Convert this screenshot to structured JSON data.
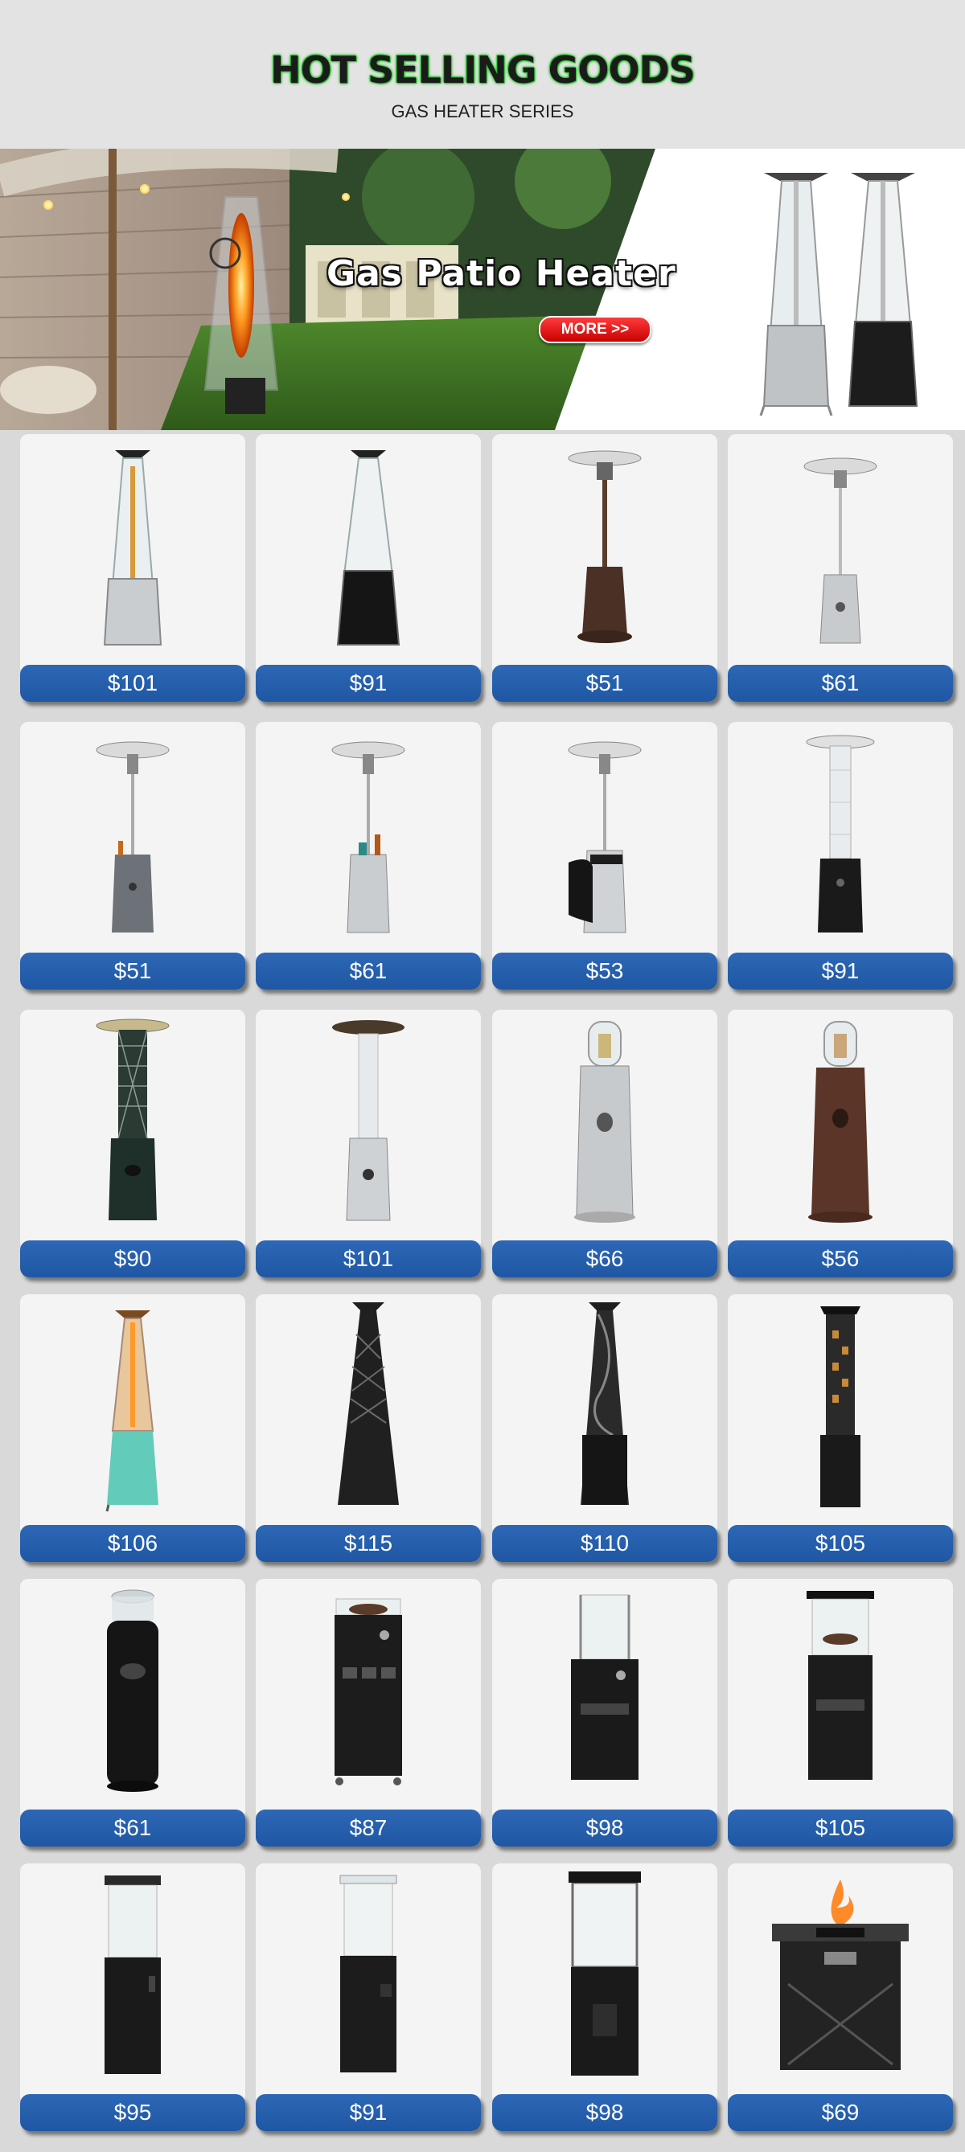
{
  "header": {
    "title": "HOT SELLING GOODS",
    "subtitle": "GAS HEATER SERIES"
  },
  "banner": {
    "headline": "Gas Patio Heater",
    "more_label": "MORE >>"
  },
  "colors": {
    "accent_blue": "#2261ad",
    "title_glow": "#27c52a",
    "more_red": "#e01010"
  },
  "products": [
    {
      "price": "$101",
      "icon": "pyramid-glass-heater-silver-icon"
    },
    {
      "price": "$91",
      "icon": "pyramid-glass-heater-black-icon"
    },
    {
      "price": "$51",
      "icon": "mushroom-heater-bronze-icon"
    },
    {
      "price": "$61",
      "icon": "mushroom-heater-silver-icon"
    },
    {
      "price": "$51",
      "icon": "mushroom-heater-table-gray-icon"
    },
    {
      "price": "$61",
      "icon": "mushroom-heater-table-steel-icon"
    },
    {
      "price": "$53",
      "icon": "mushroom-heater-door-icon"
    },
    {
      "price": "$91",
      "icon": "flame-tube-heater-black-icon"
    },
    {
      "price": "$90",
      "icon": "mesh-tube-heater-green-icon"
    },
    {
      "price": "$101",
      "icon": "flame-tube-heater-steel-icon"
    },
    {
      "price": "$66",
      "icon": "dome-heater-steel-icon"
    },
    {
      "price": "$56",
      "icon": "dome-heater-bronze-icon"
    },
    {
      "price": "$106",
      "icon": "pyramid-heater-led-icon"
    },
    {
      "price": "$115",
      "icon": "pyramid-heater-lattice-black-icon"
    },
    {
      "price": "$110",
      "icon": "pyramid-heater-twist-black-icon"
    },
    {
      "price": "$105",
      "icon": "square-tower-heater-icon"
    },
    {
      "price": "$61",
      "icon": "cylinder-fire-heater-icon"
    },
    {
      "price": "$87",
      "icon": "cabinet-log-heater-icon"
    },
    {
      "price": "$98",
      "icon": "cabinet-glass-heater-icon"
    },
    {
      "price": "$105",
      "icon": "cabinet-roof-heater-icon"
    },
    {
      "price": "$95",
      "icon": "column-glass-heater-icon"
    },
    {
      "price": "$91",
      "icon": "column-glass-heater-round-icon"
    },
    {
      "price": "$98",
      "icon": "tall-glass-tower-heater-icon"
    },
    {
      "price": "$69",
      "icon": "fire-pit-table-icon"
    }
  ]
}
